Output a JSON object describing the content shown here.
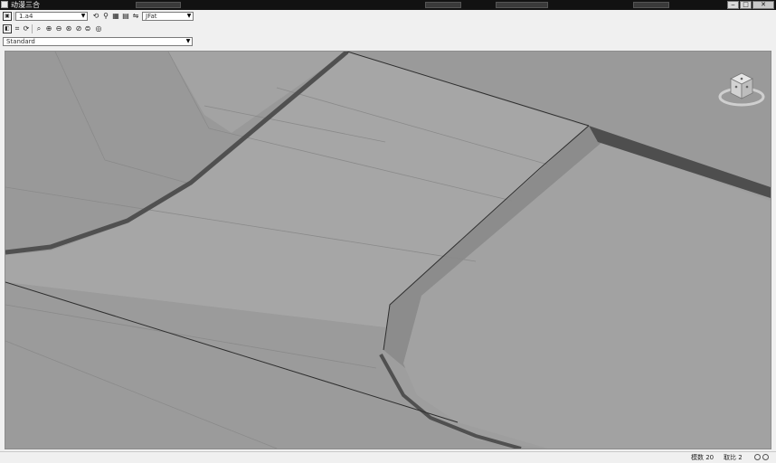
{
  "window": {
    "title": "动漫三合",
    "controls": {
      "minimize": "‒",
      "maximize": "□",
      "close": "✕"
    }
  },
  "toolbar1": {
    "view_select": {
      "value": "1.a4"
    },
    "layer_select": {
      "value": "JFat"
    }
  },
  "toolbar2": {
    "icons": [
      "select-icon",
      "crop-icon",
      "rotate-icon",
      "zoom-window-icon",
      "zoom-in-icon",
      "zoom-out-icon",
      "zoom-extents-icon",
      "zoom-prev-icon",
      "zoom-fit-icon",
      "render-icon"
    ]
  },
  "toolbar3": {
    "style_select": {
      "value": "Standard"
    }
  },
  "viewcube": {
    "label": "viewcube"
  },
  "statusbar": {
    "label1": "模数 20",
    "label2": "取比 2"
  },
  "colors": {
    "viewport_bg": "#9d9d9d",
    "edge_dark": "#4a4a4a",
    "surface_light": "#a8a8a8"
  }
}
